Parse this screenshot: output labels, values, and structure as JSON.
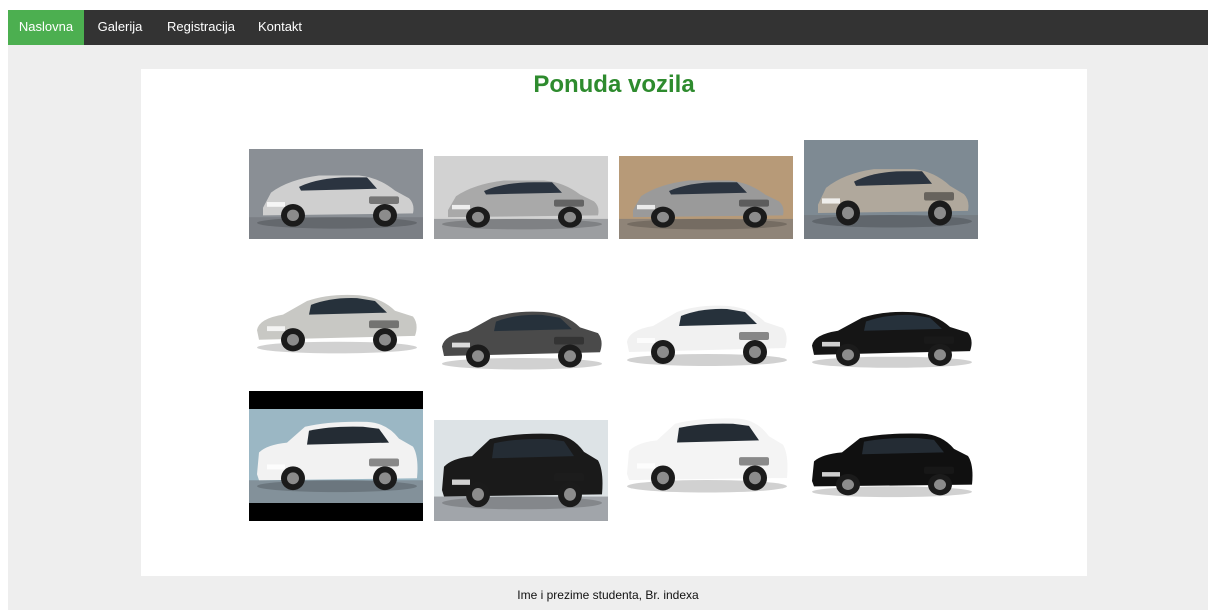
{
  "nav": {
    "items": [
      {
        "label": "Naslovna",
        "active": true
      },
      {
        "label": "Galerija",
        "active": false
      },
      {
        "label": "Registracija",
        "active": false
      },
      {
        "label": "Kontakt",
        "active": false
      }
    ]
  },
  "main": {
    "title": "Ponuda vozila"
  },
  "footer": {
    "text": "Ime i prezime studenta, Br. indexa"
  },
  "colors": {
    "nav_bg": "#333333",
    "nav_active": "#4caf50",
    "title": "#2e8b2e",
    "page_bg": "#eeeeee"
  },
  "gallery": {
    "images": [
      {
        "name": "car-image-a-class-silver-1",
        "body": "hatch",
        "color": "#cfcfcf",
        "bg": "#8a8f95"
      },
      {
        "name": "car-image-a-class-silver-2",
        "body": "hatch",
        "color": "#a9a9a9",
        "bg": "#d2d2d2"
      },
      {
        "name": "car-image-a-class-silver-3",
        "body": "hatch",
        "color": "#9a9a9a",
        "bg": "#b79a78"
      },
      {
        "name": "car-image-a-class-silver-4",
        "body": "hatch",
        "color": "#b0a89c",
        "bg": "#7e8a93"
      },
      {
        "name": "car-image-c-class-silver",
        "body": "sedan",
        "color": "#c8c8c4",
        "bg": "#ffffff"
      },
      {
        "name": "car-image-c-class-grey",
        "body": "sedan",
        "color": "#4a4a4a",
        "bg": "#ffffff"
      },
      {
        "name": "car-image-c-class-white",
        "body": "sedan",
        "color": "#f1f1f1",
        "bg": "#ffffff"
      },
      {
        "name": "car-image-c-class-black",
        "body": "sedan",
        "color": "#151515",
        "bg": "#ffffff"
      },
      {
        "name": "car-image-gls-white",
        "body": "suv",
        "color": "#f2f2f2",
        "bg": "#9bb7c4"
      },
      {
        "name": "car-image-gle-black",
        "body": "suv",
        "color": "#1a1a1a",
        "bg": "#dde3e6"
      },
      {
        "name": "car-image-gle-coupe-white",
        "body": "suv",
        "color": "#f4f4f4",
        "bg": "#ffffff"
      },
      {
        "name": "car-image-gle-black-2",
        "body": "suv",
        "color": "#101010",
        "bg": "#ffffff"
      }
    ]
  }
}
